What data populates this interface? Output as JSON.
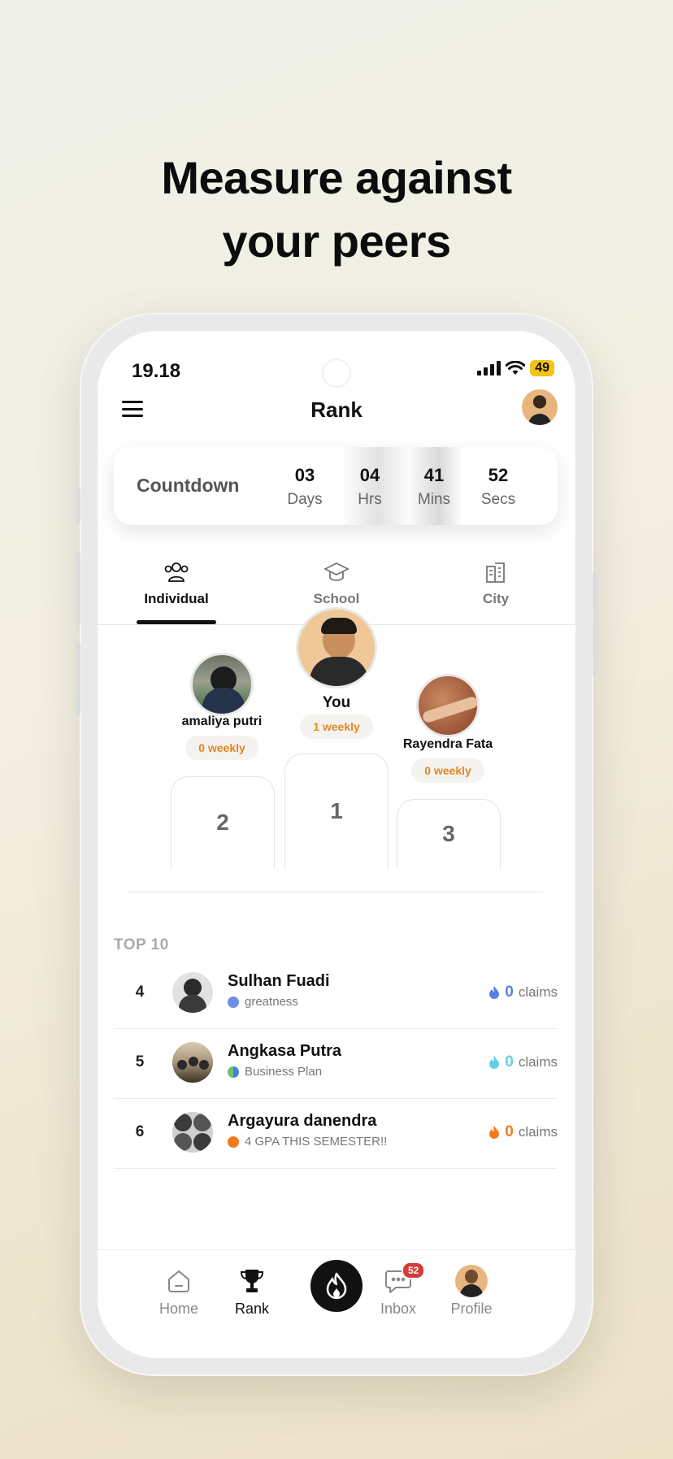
{
  "headline": {
    "line1": "Measure against",
    "line2": "your peers"
  },
  "status_bar": {
    "time": "19.18",
    "battery": "49"
  },
  "header": {
    "title": "Rank"
  },
  "countdown": {
    "label": "Countdown",
    "units": [
      {
        "value": "03",
        "name": "Days"
      },
      {
        "value": "04",
        "name": "Hrs"
      },
      {
        "value": "41",
        "name": "Mins"
      },
      {
        "value": "52",
        "name": "Secs"
      }
    ]
  },
  "tabs": [
    {
      "label": "Individual",
      "icon": "people-icon",
      "active": true
    },
    {
      "label": "School",
      "icon": "graduation-cap-icon",
      "active": false
    },
    {
      "label": "City",
      "icon": "buildings-icon",
      "active": false
    }
  ],
  "podium": {
    "first": {
      "name": "You",
      "badge": "1 weekly",
      "place": "1"
    },
    "second": {
      "name": "amaliya putri",
      "badge": "0 weekly",
      "place": "2"
    },
    "third": {
      "name": "Rayendra Fata",
      "badge": "0 weekly",
      "place": "3"
    }
  },
  "top10": {
    "title": "TOP 10",
    "rows": [
      {
        "rank": "4",
        "name": "Sulhan Fuadi",
        "sub": "greatness",
        "count": "0",
        "unit": "claims",
        "flame_color": "#5b7fe8"
      },
      {
        "rank": "5",
        "name": "Angkasa Putra",
        "sub": "Business Plan",
        "count": "0",
        "unit": "claims",
        "flame_color": "#5fd0e6"
      },
      {
        "rank": "6",
        "name": "Argayura danendra",
        "sub": "4 GPA THIS SEMESTER!!",
        "count": "0",
        "unit": "claims",
        "flame_color": "#f07b1e"
      }
    ]
  },
  "bottom_nav": {
    "home": "Home",
    "rank": "Rank",
    "inbox": "Inbox",
    "inbox_badge": "52",
    "profile": "Profile"
  },
  "colors": {
    "accent_orange": "#e5861f",
    "badge_red": "#d63a3a",
    "battery_yellow": "#f3c316"
  }
}
